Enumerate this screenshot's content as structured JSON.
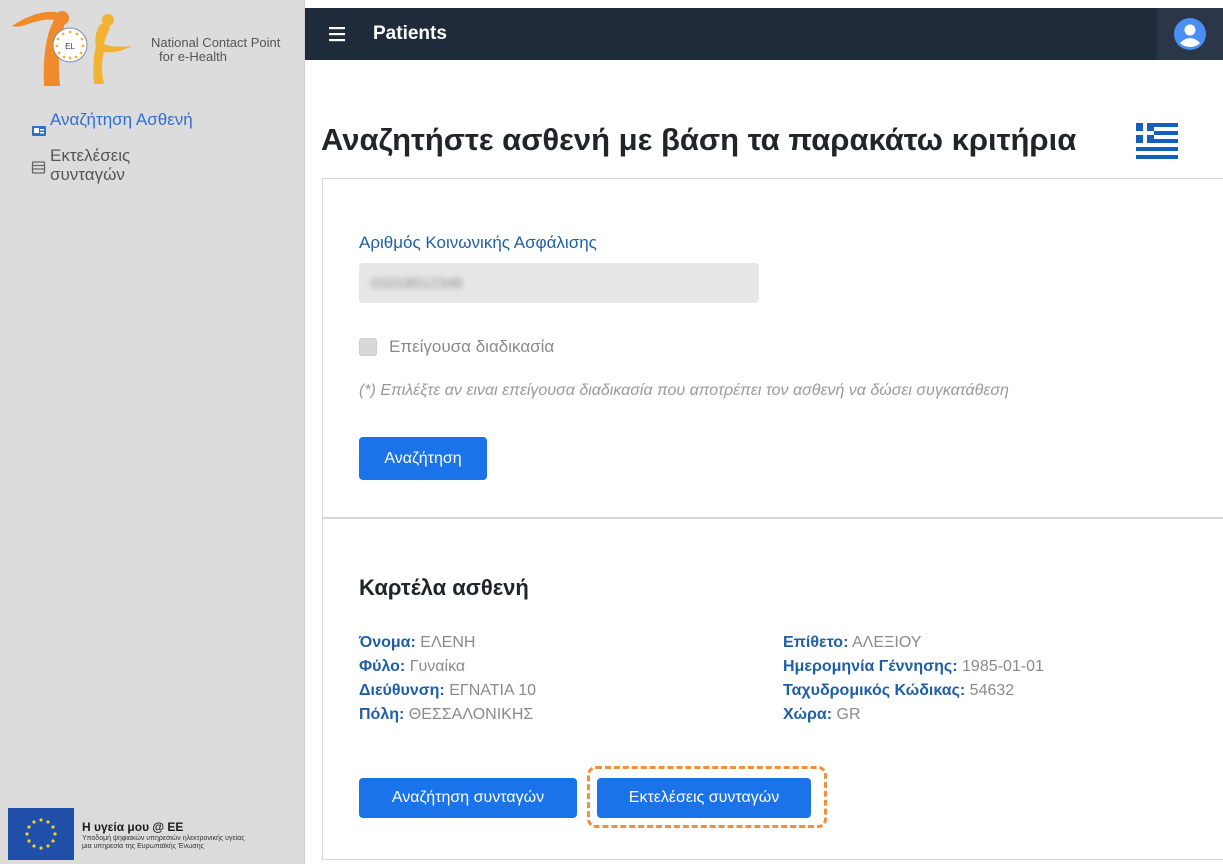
{
  "sidebar": {
    "brand": {
      "line1": "National Contact Point",
      "line2": "for e-Health",
      "badge": "EL"
    },
    "items": [
      {
        "label": "Αναζήτηση Ασθενή",
        "icon": "id-card-icon",
        "active": true
      },
      {
        "label": "Εκτελέσεις συνταγών",
        "icon": "list-icon",
        "active": false
      }
    ],
    "footer": {
      "title": "Η υγεία μου @ ΕΕ",
      "sub1": "Υποδομή ψηφιακών υπηρεσιών ηλεκτρονικής υγείας",
      "sub2": "μια υπηρεσία της Ευρωπαϊκής Ένωσης"
    }
  },
  "topbar": {
    "title": "Patients"
  },
  "main": {
    "title": "Αναζητήστε ασθενή με βάση τα παρακάτω κριτήρια",
    "search": {
      "label": "Αριθμός Κοινωνικής Ασφάλισης",
      "value": "01018512346",
      "emergency_label": "Επείγουσα διαδικασία",
      "hint": "(*) Επιλέξτε αν ειναι επείγουσα διαδικασία που αποτρέπει τον ασθενή να δώσει συγκατάθεση",
      "button": "Αναζήτηση"
    },
    "patient": {
      "title": "Καρτέλα ασθενή",
      "first_name_label": "Όνομα:",
      "first_name": "ΕΛΕΝΗ",
      "gender_label": "Φύλο:",
      "gender": "Γυναίκα",
      "address_label": "Διεύθυνση:",
      "address": "ΕΓΝΑΤΙΑ 10",
      "city_label": "Πόλη:",
      "city": "ΘΕΣΣΑΛΟΝΙΚΗΣ",
      "last_name_label": "Επίθετο:",
      "last_name": "ΑΛΕΞΙΟΥ",
      "dob_label": "Ημερομηνία Γέννησης:",
      "dob": "1985-01-01",
      "postal_label": "Ταχυδρομικός Κώδικας:",
      "postal": "54632",
      "country_label": "Χώρα:",
      "country": "GR",
      "btn_search_rx": "Αναζήτηση συνταγών",
      "btn_exec_rx": "Εκτελέσεις συνταγών"
    }
  },
  "colors": {
    "primary": "#1a73e8",
    "topbar": "#1f2a3a",
    "highlight": "#f0903a",
    "label": "#1f5fa8"
  }
}
